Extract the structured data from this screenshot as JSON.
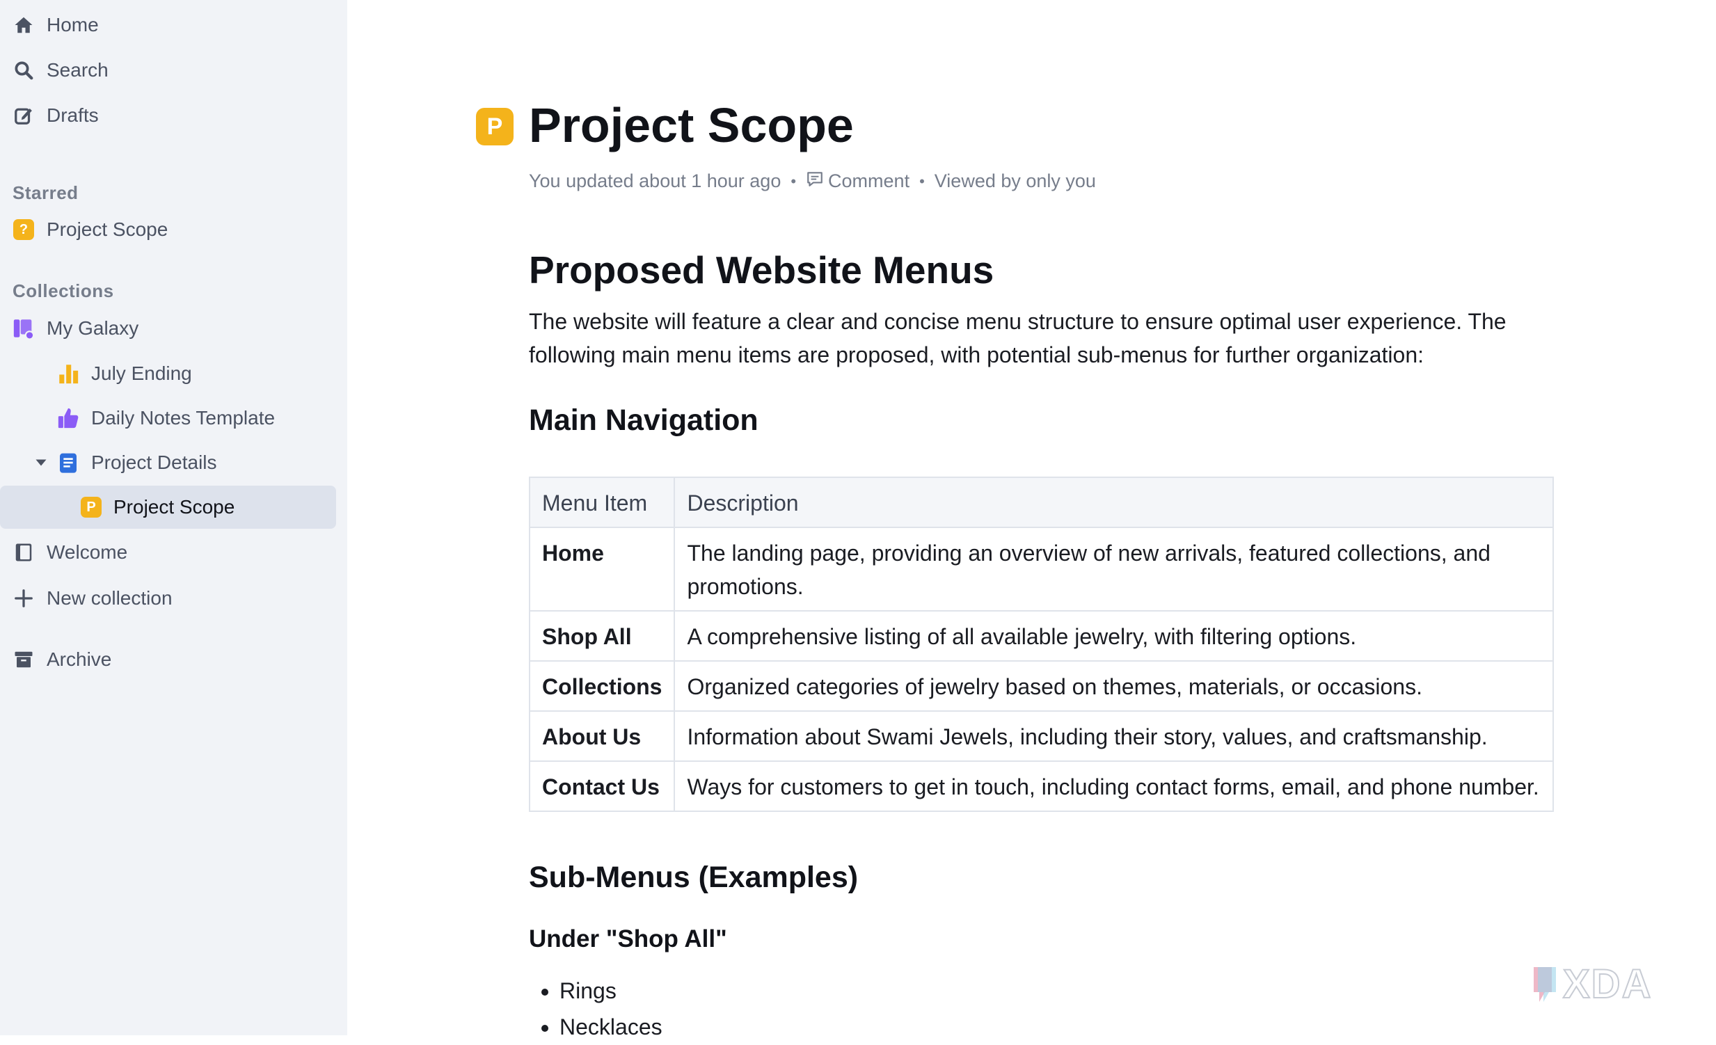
{
  "sidebar": {
    "top": [
      {
        "label": "Home",
        "icon": "home-icon"
      },
      {
        "label": "Search",
        "icon": "search-icon"
      },
      {
        "label": "Drafts",
        "icon": "edit-icon"
      }
    ],
    "starred_title": "Starred",
    "starred": [
      {
        "label": "Project Scope",
        "badge": "?"
      }
    ],
    "collections_title": "Collections",
    "collections": {
      "my_galaxy": "My Galaxy",
      "july_ending": "July Ending",
      "daily_notes": "Daily Notes Template",
      "project_details": "Project Details",
      "project_scope": "Project Scope",
      "project_scope_badge": "P",
      "welcome": "Welcome",
      "new_collection": "New collection"
    },
    "archive": "Archive"
  },
  "doc": {
    "icon_letter": "P",
    "title": "Project Scope",
    "meta": {
      "updated": "You updated about 1 hour ago",
      "comment": "Comment",
      "viewed": "Viewed by only you"
    },
    "h2": "Proposed Website Menus",
    "intro": "The website will feature a clear and concise menu structure to ensure optimal user experience. The following main menu items are proposed, with potential sub-menus for further organization:",
    "main_nav_heading": "Main Navigation",
    "table": {
      "headers": [
        "Menu Item",
        "Description"
      ],
      "rows": [
        [
          "Home",
          "The landing page, providing an overview of new arrivals, featured collections, and promotions."
        ],
        [
          "Shop All",
          "A comprehensive listing of all available jewelry, with filtering options."
        ],
        [
          "Collections",
          "Organized categories of jewelry based on themes, materials, or occasions."
        ],
        [
          "About Us",
          "Information about Swami Jewels, including their story, values, and craftsmanship."
        ],
        [
          "Contact Us",
          "Ways for customers to get in touch, including contact forms, email, and phone number."
        ]
      ]
    },
    "submenus_heading": "Sub-Menus (Examples)",
    "under_shop_all": "Under \"Shop All\"",
    "bullets": [
      "Rings",
      "Necklaces"
    ]
  },
  "colors": {
    "accent_yellow": "#f4b31b",
    "sidebar_bg": "#f1f3f7",
    "active_bg": "#dde2ec",
    "purple": "#8b5cf6",
    "blue": "#2f6fdd"
  },
  "watermark": "XDA"
}
